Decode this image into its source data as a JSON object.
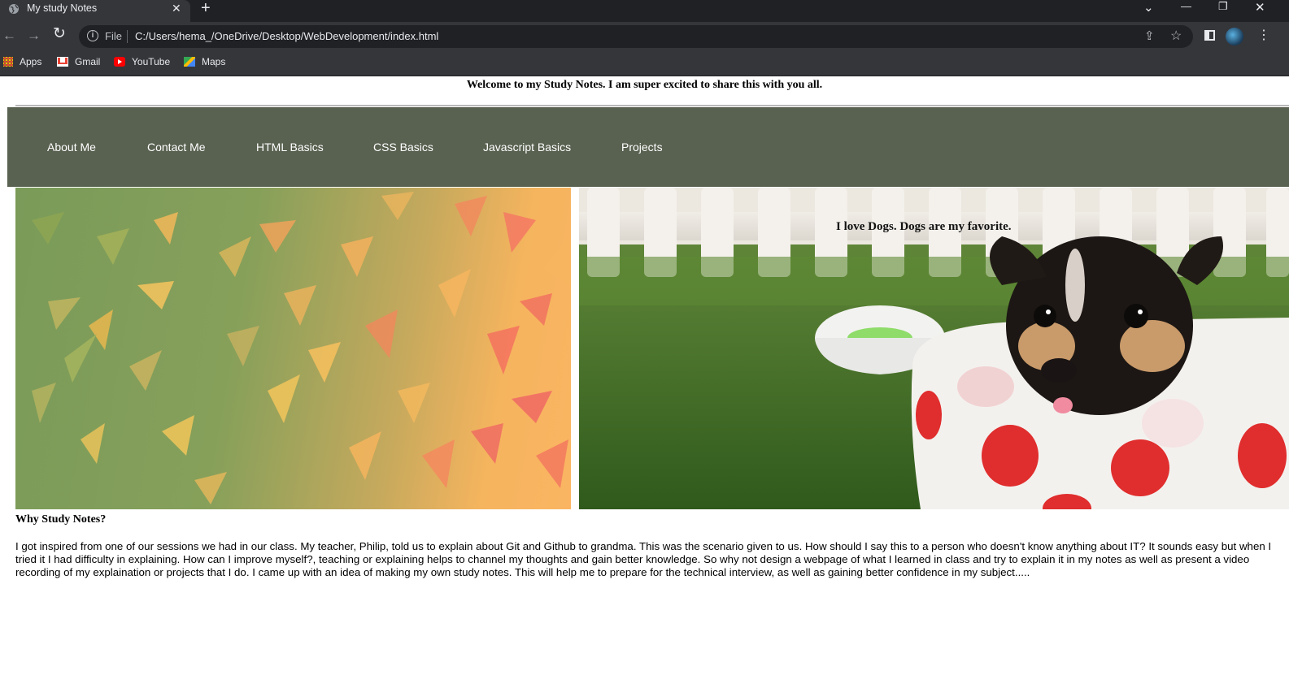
{
  "browser": {
    "tab_title": "My study Notes",
    "tab_close_glyph": "✕",
    "new_tab_glyph": "+",
    "window_controls": {
      "tab_search": "⌄",
      "minimize": "—",
      "restore": "❐",
      "close": "✕"
    },
    "nav": {
      "back": "←",
      "forward": "→",
      "reload": "↻"
    },
    "scheme_label": "File",
    "url": "C:/Users/hema_/OneDrive/Desktop/WebDevelopment/index.html",
    "share_glyph": "⇪",
    "bookmark_star_glyph": "☆",
    "menu_glyph": "⋮",
    "bookmarks": [
      {
        "label": "Apps",
        "icon": "apps-grid-icon"
      },
      {
        "label": "Gmail",
        "icon": "gmail-icon"
      },
      {
        "label": "YouTube",
        "icon": "youtube-icon"
      },
      {
        "label": "Maps",
        "icon": "maps-icon"
      }
    ]
  },
  "page": {
    "welcome": "Welcome to my Study Notes. I am super excited to share this with you all.",
    "nav_links": [
      "About Me",
      "Contact Me",
      "HTML Basics",
      "CSS Basics",
      "Javascript Basics",
      "Projects"
    ],
    "dog_caption": "I love Dogs. Dogs are my favorite.",
    "why_title": "Why Study Notes?",
    "why_body": "I got inspired from one of our sessions we had in our class. My teacher, Philip, told us to explain about Git and Github to grandma. This was the scenario given to us. How should I say this to a person who doesn't know anything about IT? It sounds easy but when I tried it I had difficulty in explaining. How can I improve myself?, teaching or explaining helps to channel my thoughts and gain better knowledge. So why not design a webpage of what I learned in class and try to explain it in my notes as well as present a video recording of my explaination or projects that I do. I came up with an idea of making my own study notes. This will help me to prepare for the technical interview, as well as gaining better confidence in my subject.....",
    "colors": {
      "navbar": "#596150",
      "nav_text": "#ffffff",
      "divider": "#b8b8b8"
    }
  }
}
